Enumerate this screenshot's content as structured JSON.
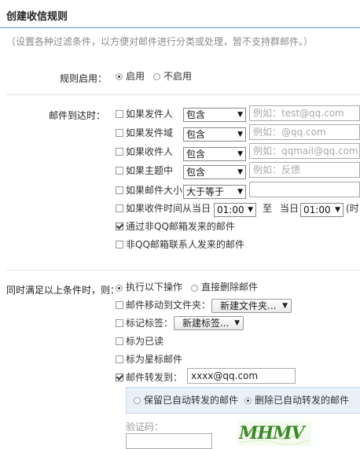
{
  "title": "创建收信规则",
  "description": "（设置各种过滤条件，以方便对邮件进行分类或处理，暂不支持群邮件。）",
  "enable": {
    "label": "规则启用：",
    "on": "启用",
    "off": "不启用"
  },
  "arrival": {
    "label": "邮件到达时：",
    "rows": [
      {
        "label": "如果发件人",
        "op": "包含",
        "placeholder": "例如：test@qq.com"
      },
      {
        "label": "如果发件域",
        "op": "包含",
        "placeholder": "例如：@qq.com"
      },
      {
        "label": "如果收件人",
        "op": "包含",
        "placeholder": "例如：qqmail@qq.com"
      },
      {
        "label": "如果主题中",
        "op": "包含",
        "placeholder": "例如：反馈"
      },
      {
        "label": "如果邮件大小",
        "op": "大于等于",
        "placeholder": ""
      }
    ],
    "time": {
      "label": "如果收件时间从当日",
      "from": "01:00",
      "to_label": "至",
      "same_day": "当日",
      "to": "01:00",
      "tail": "(时"
    },
    "non_qq": "通过非QQ邮箱发来的邮件",
    "non_contact": "非QQ邮箱联系人发来的邮件"
  },
  "actions": {
    "label": "同时满足以上条件时，则：",
    "exec": "执行以下操作",
    "delete": "直接删除邮件",
    "move_label": "邮件移动到文件夹：",
    "move_select": "新建文件夹...",
    "tag_label": "标记标签：",
    "tag_select": "新建标签...",
    "mark_read": "标为已读",
    "mark_star": "标为星标邮件",
    "forward_label": "邮件转发到：",
    "forward_value": "xxxx@qq.com",
    "keep_auto": "保留已自动转发的邮件",
    "delete_auto": "删除已自动转发的邮件",
    "captcha_label": "验证码：",
    "captcha_text": "MHMV"
  }
}
